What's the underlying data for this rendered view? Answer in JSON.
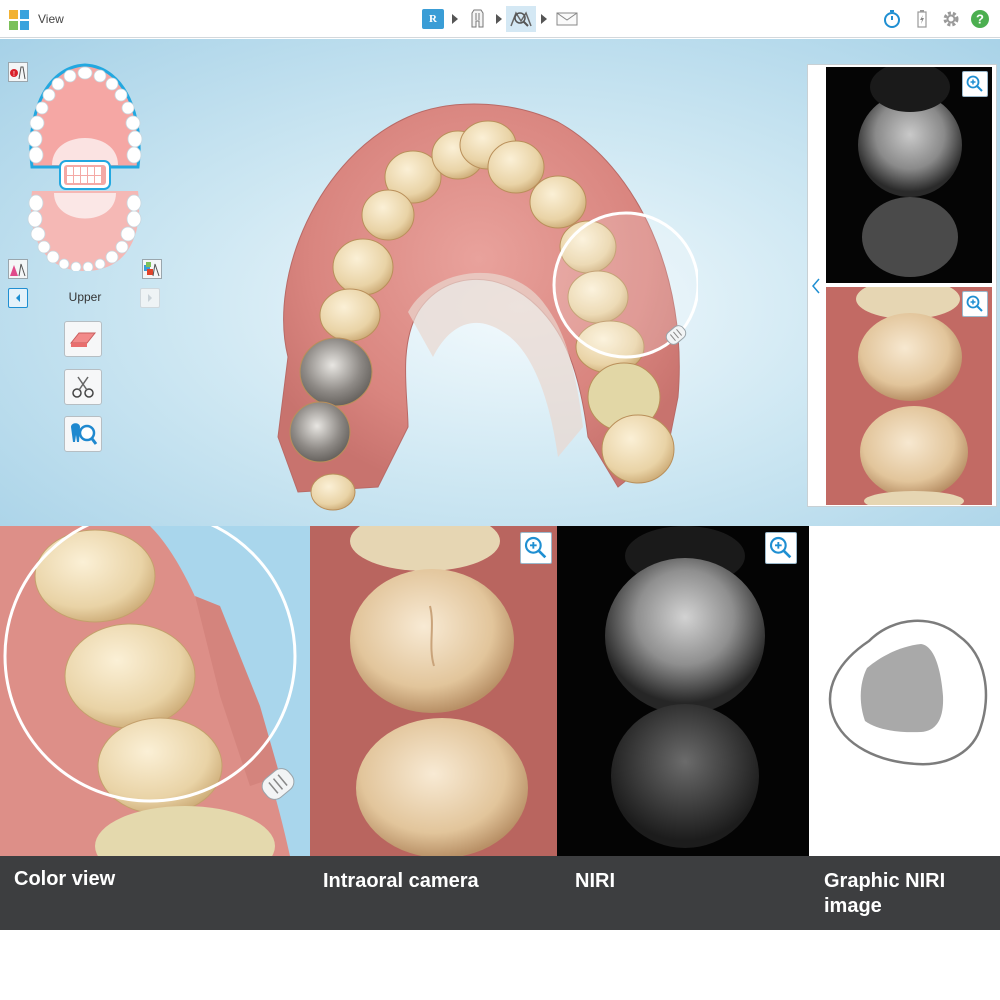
{
  "toolbar": {
    "title": "View",
    "steps": [
      {
        "name": "rx",
        "label": "R",
        "icon": "rx-icon"
      },
      {
        "name": "scan",
        "icon": "scan-icon"
      },
      {
        "name": "view",
        "icon": "view-tool-icon",
        "active": true
      },
      {
        "name": "send",
        "icon": "send-icon"
      }
    ],
    "right_icons": [
      "timer-icon",
      "battery-icon",
      "settings-gear-icon",
      "help-icon"
    ],
    "colors": {
      "accent": "#1f8fd2",
      "help": "#4caf50"
    }
  },
  "left_panel": {
    "jaw_label": "Upper",
    "tools": [
      "eraser-tool-icon",
      "scissors-tool-icon",
      "tooth-magnify-tool-icon"
    ]
  },
  "right_panel": {
    "thumbnails": [
      "niri-thumbnail",
      "intraoral-camera-thumbnail"
    ],
    "collapse_icon": "chevron-left-icon"
  },
  "bottom_panels": [
    {
      "name": "color-view",
      "caption": "Color view"
    },
    {
      "name": "intraoral-camera",
      "caption": "Intraoral camera"
    },
    {
      "name": "niri",
      "caption": "NIRI"
    },
    {
      "name": "graphic-niri",
      "caption": "Graphic NIRI image"
    }
  ]
}
